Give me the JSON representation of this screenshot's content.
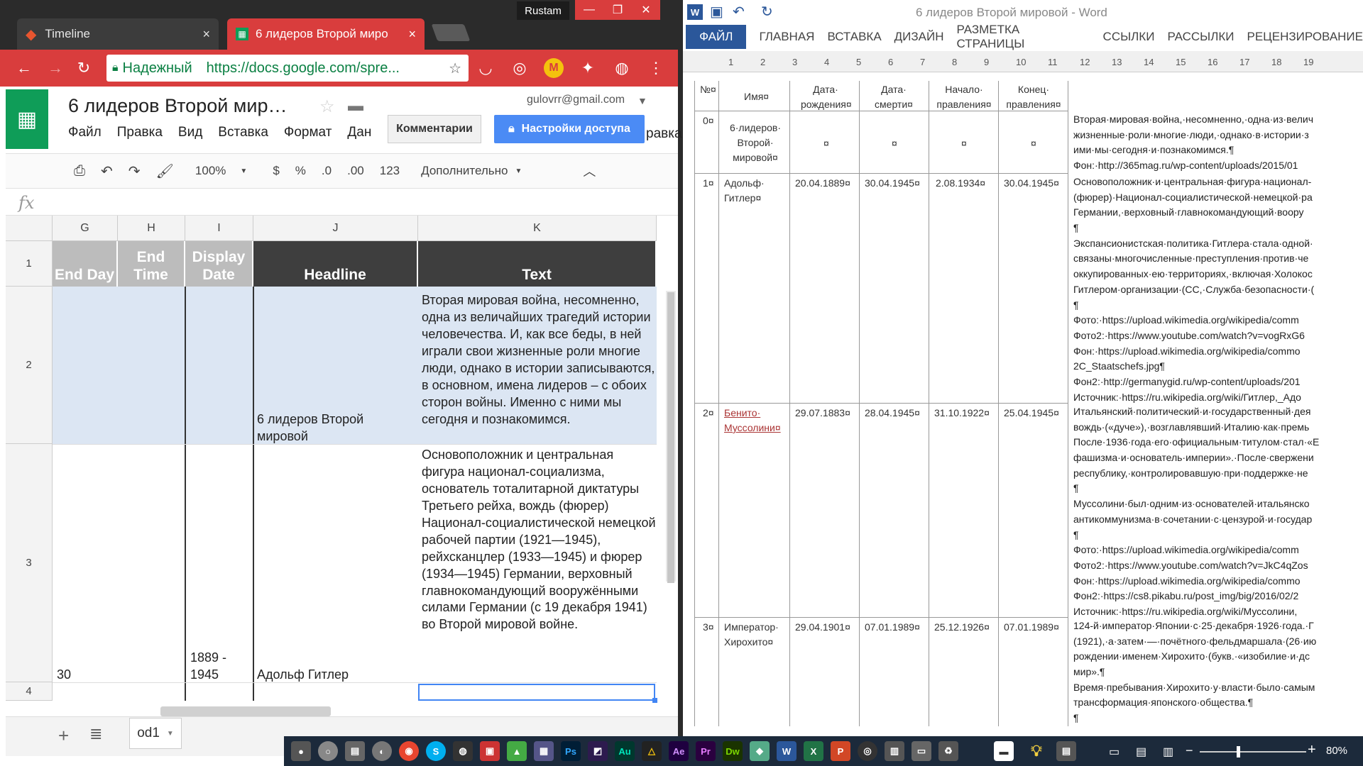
{
  "chrome": {
    "tab1_title": "Timeline",
    "tab2_title": "6 лидеров Второй миро",
    "profile": "Rustam",
    "secure_label": "Надежный",
    "url": "https://docs.google.com/spre..."
  },
  "sheets": {
    "doc_title": "6 лидеров Второй мир…",
    "menu": [
      "Файл",
      "Правка",
      "Вид",
      "Вставка",
      "Формат",
      "Дан"
    ],
    "menu_tail": "равка",
    "email": "gulovrr@gmail.com",
    "comments_btn": "Комментарии",
    "share_btn": "Настройки доступа",
    "toolbar": {
      "zoom": "100%",
      "currency": "$",
      "percent": "%",
      "dec_less": ".0",
      "dec_more": ".00",
      "format": "123",
      "more": "Дополнительно"
    },
    "fx": "fx",
    "columns": [
      "G",
      "H",
      "I",
      "J",
      "K"
    ],
    "header_row": {
      "g": "End Day",
      "h": "End Time",
      "i": "Display Date",
      "j": "Headline",
      "k": "Text"
    },
    "row_numbers": [
      "1",
      "2",
      "3",
      "4"
    ],
    "row2": {
      "headline": "6 лидеров Второй мировой",
      "text": "Вторая мировая война, несомненно, одна из величайших трагедий истории человечества. И, как все беды, в ней играли свои жизненные роли многие люди, однако в истории записываются, в основном, имена лидеров – с обоих сторон войны. Именно с ними мы сегодня и познакомимся."
    },
    "row3": {
      "end_day": "30",
      "display_date": "1889 - 1945",
      "headline": "Адольф Гитлер",
      "text": "Основоположник и центральная фигура национал-социализма, основатель тоталитарной диктатуры Третьего рейха, вождь (фюрер) Национал-социалистической немецкой рабочей партии (1921—1945), рейхсканцлер (1933—1945) и фюрер (1934—1945) Германии, верховный главнокомандующий вооружёнными силами Германии (с 19 декабря 1941) во Второй мировой войне."
    },
    "sheet_tab": "od1"
  },
  "word": {
    "title": "6 лидеров Второй мировой - Word",
    "ribbon": [
      "ФАЙЛ",
      "ГЛАВНАЯ",
      "ВСТАВКА",
      "ДИЗАЙН",
      "РАЗМЕТКА СТРАНИЦЫ",
      "ССЫЛКИ",
      "РАССЫЛКИ",
      "РЕЦЕНЗИРОВАНИЕ"
    ],
    "ruler": [
      "1",
      "2",
      "3",
      "4",
      "5",
      "6",
      "7",
      "8",
      "9",
      "10",
      "11",
      "12",
      "13",
      "14",
      "15",
      "16",
      "17",
      "18",
      "19"
    ],
    "table_header": [
      "№¤",
      "Имя¤",
      "Дата· рождения¤",
      "Дата· смерти¤",
      "Начало· правления¤",
      "Конец· правления¤"
    ],
    "rows": [
      {
        "num": "0¤",
        "name": "6·лидеров· Второй· мировой¤",
        "birth": "¤",
        "death": "¤",
        "start": "¤",
        "end": "¤",
        "text": [
          "Вторая·мировая·война,·несомненно,·одна·из·велич",
          "жизненные·роли·многие·люди,·однако·в·истории·з",
          "ими·мы·сегодня·и·познакомимся.¶",
          "Фон:·http://365mag.ru/wp-content/uploads/2015/01"
        ]
      },
      {
        "num": "1¤",
        "name": "Адольф· Гитлер¤",
        "birth": "20.04.1889¤",
        "death": "30.04.1945¤",
        "start": "2.08.1934¤",
        "end": "30.04.1945¤",
        "text": [
          "Основоположник·и·центральная·фигура·национал-",
          "(фюрер)·Национал-социалистической·немецкой·ра",
          "Германии,·верховный·главнокомандующий·воору",
          "¶",
          "Экспансионистская·политика·Гитлера·стала·одной·",
          "связаны·многочисленные·преступления·против·че",
          "оккупированных·ею·территориях,·включая·Холокос",
          "Гитлером·организации·(СС,·Служба·безопасности·(",
          "¶",
          "Фото:·https://upload.wikimedia.org/wikipedia/comm",
          "Фото2:·https://www.youtube.com/watch?v=vogRxG6",
          "Фон:·https://upload.wikimedia.org/wikipedia/commo",
          "2C_Staatschefs.jpg¶",
          "Фон2:·http://germanygid.ru/wp-content/uploads/201",
          "Источник:·https://ru.wikipedia.org/wiki/Гитлер,_Адо"
        ]
      },
      {
        "num": "2¤",
        "name": "Бенито· Муссолини¤",
        "birth": "29.07.1883¤",
        "death": "28.04.1945¤",
        "start": "31.10.1922¤",
        "end": "25.04.1945¤",
        "text": [
          "Итальянский·политический·и·государственный·дея",
          "вождь·(«дуче»),·возглавлявший·Италию·как·премь",
          "После·1936·года·его·официальным·титулом·стал·«Е",
          "фашизма·и·основатель·империи».·После·свержени",
          "республику,·контролировавшую·при·поддержке·не",
          "¶",
          "Муссолини·был·одним·из·основателей·итальянско",
          "антикоммунизма·в·сочетании·с·цензурой·и·государ",
          "¶",
          "Фото:·https://upload.wikimedia.org/wikipedia/comm",
          "Фото2:·https://www.youtube.com/watch?v=JkC4qZos",
          "Фон:·https://upload.wikimedia.org/wikipedia/commo",
          "Фон2:·https://cs8.pikabu.ru/post_img/big/2016/02/2",
          "Источник:·https://ru.wikipedia.org/wiki/Муссолини,"
        ]
      },
      {
        "num": "3¤",
        "name": "Император· Хирохито¤",
        "birth": "29.04.1901¤",
        "death": "07.01.1989¤",
        "start": "25.12.1926¤",
        "end": "07.01.1989¤",
        "text": [
          "124-й·император·Японии·с·25·декабря·1926·года.·Г",
          "(1921),·а·затем·—·почётного·фельдмаршала·(26·ию",
          "рождении·именем·Хирохито·(букв.·«изобилие·и·дс",
          "мир».¶",
          "Время·пребывания·Хирохито·у·власти·было·самым",
          "трансформация·японского·общества.¶",
          "¶"
        ]
      }
    ],
    "zoom": "80%"
  }
}
